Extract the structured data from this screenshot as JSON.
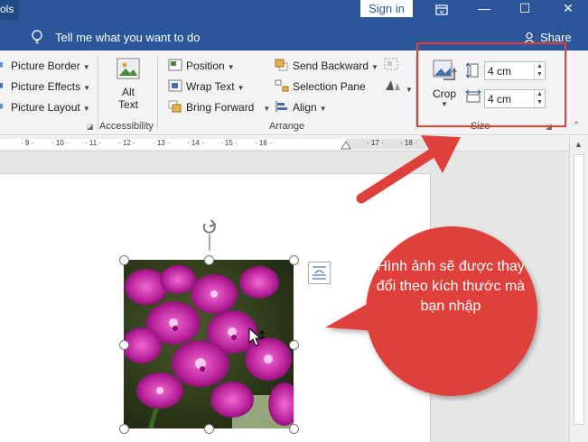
{
  "titlebar": {
    "tools_fragment": "ols",
    "signin": "Sign in",
    "restore_icon": "ribbon-display-icon",
    "minimize": "—",
    "maximize": "☐",
    "close": "✕"
  },
  "tellme": {
    "text": "Tell me what you want to do",
    "share": "Share"
  },
  "ribbon": {
    "picture_styles": {
      "border": "Picture Border",
      "effects": "Picture Effects",
      "layout": "Picture Layout"
    },
    "accessibility": {
      "alt_text_line1": "Alt",
      "alt_text_line2": "Text",
      "group_label": "Accessibility"
    },
    "arrange": {
      "position": "Position",
      "wrap_text": "Wrap Text",
      "bring_forward": "Bring Forward",
      "send_backward": "Send Backward",
      "selection_pane": "Selection Pane",
      "align": "Align",
      "group_label": "Arrange"
    },
    "size": {
      "crop": "Crop",
      "height_value": "4 cm",
      "width_value": "4 cm",
      "group_label": "Size"
    }
  },
  "ruler": {
    "numbers": [
      "· 9 ·",
      "· 10 ·",
      "· 11 ·",
      "· 12 ·",
      "· 13 ·",
      "· 14 ·",
      "· 15 ·",
      "· 16 ·",
      "· 17 ·",
      "· 18 ·"
    ]
  },
  "callout": {
    "text": "Hình ảnh sẽ được thay đổi theo kích thước mà bạn nhập",
    "color": "#e0403b"
  },
  "colors": {
    "word_blue": "#2b579a",
    "highlight_red": "#e0403b",
    "orchid": "#b0208e"
  }
}
